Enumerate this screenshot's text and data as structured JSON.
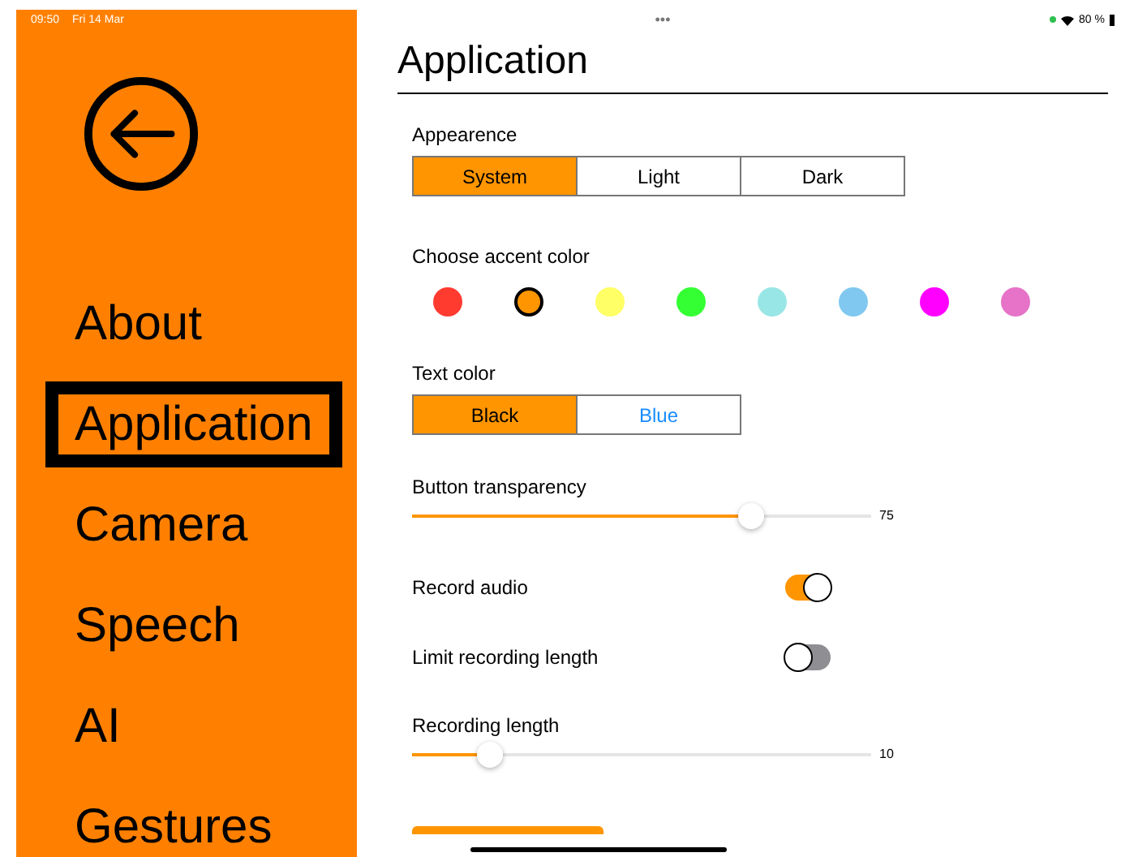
{
  "status_bar": {
    "time": "09:50",
    "date": "Fri 14 Mar",
    "handle": "•••",
    "battery_text": "80 %"
  },
  "sidebar": {
    "items": [
      {
        "label": "About",
        "selected": false
      },
      {
        "label": "Application",
        "selected": true
      },
      {
        "label": "Camera",
        "selected": false
      },
      {
        "label": "Speech",
        "selected": false
      },
      {
        "label": "AI",
        "selected": false
      },
      {
        "label": "Gestures",
        "selected": false
      }
    ]
  },
  "page": {
    "title": "Application"
  },
  "settings": [
    {
      "kind": "segmented",
      "label": "Appearence",
      "options": [
        {
          "label": "System",
          "selected": true
        },
        {
          "label": "Light",
          "selected": false
        },
        {
          "label": "Dark",
          "selected": false
        }
      ]
    },
    {
      "kind": "colors",
      "label": "Choose accent color",
      "swatches": [
        {
          "color": "#ff3b30",
          "selected": false
        },
        {
          "color": "#ff9500",
          "selected": true
        },
        {
          "color": "#ffff66",
          "selected": false
        },
        {
          "color": "#33ff33",
          "selected": false
        },
        {
          "color": "#99e6e6",
          "selected": false
        },
        {
          "color": "#80c8f0",
          "selected": false
        },
        {
          "color": "#ff00ff",
          "selected": false
        },
        {
          "color": "#e673c8",
          "selected": false
        }
      ]
    },
    {
      "kind": "segmented",
      "label": "Text color",
      "options": [
        {
          "label": "Black",
          "selected": true
        },
        {
          "label": "Blue",
          "selected": false,
          "color": "#1a8cff"
        }
      ]
    },
    {
      "kind": "slider",
      "label": "Button transparency",
      "level": 0.74,
      "reading": "75"
    },
    {
      "kind": "toggle",
      "label": "Record audio",
      "on": true
    },
    {
      "kind": "toggle",
      "label": "Limit recording length",
      "on": false
    },
    {
      "kind": "slider",
      "label": "Recording length",
      "level": 0.17,
      "reading": "10"
    },
    {
      "kind": "button"
    }
  ]
}
